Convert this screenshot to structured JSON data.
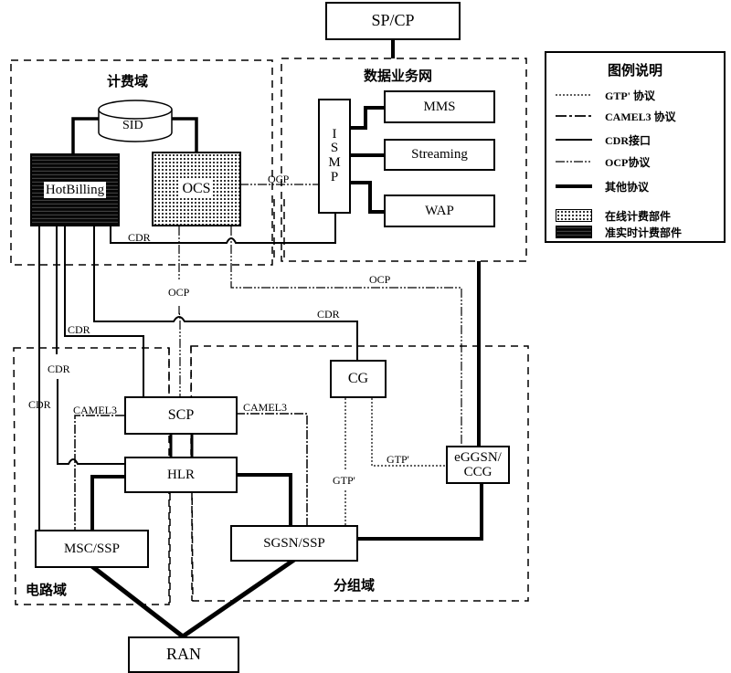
{
  "nodes": {
    "spcp": "SP/CP",
    "sid": "SID",
    "hotbilling": "HotBilling",
    "ocs": "OCS",
    "ismp": [
      "I",
      "S",
      "M",
      "P"
    ],
    "mms": "MMS",
    "streaming": "Streaming",
    "wap": "WAP",
    "cg": "CG",
    "scp": "SCP",
    "hlr": "HLR",
    "msc_ssp": "MSC/SSP",
    "sgsn_ssp": "SGSN/SSP",
    "eggsn_ccg_line1": "eGGSN/",
    "eggsn_ccg_line2": "CCG",
    "ran": "RAN"
  },
  "domains": {
    "billing": "计费域",
    "data_service": "数据业务网",
    "circuit": "电路域",
    "packet": "分组域"
  },
  "link_labels": {
    "ocp_ocs_ismp": "OCP",
    "cdr_hb_ismp": "CDR",
    "ocp_vertical": "OCP",
    "ocp_to_eggsn": "OCP",
    "cdr_to_cg": "CDR",
    "cdr_to_scp": "CDR",
    "cdr_left1": "CDR",
    "cdr_left2": "CDR",
    "camel3_left": "CAMEL3",
    "camel3_right": "CAMEL3",
    "gtp_cg_eggsn": "GTP'",
    "gtp_cg_sgsn": "GTP'"
  },
  "legend": {
    "title": "图例说明",
    "items": [
      {
        "label": "GTP' 协议",
        "style": "dotted"
      },
      {
        "label": "CAMEL3 协议",
        "style": "dash-dot"
      },
      {
        "label": "CDR接口",
        "style": "solid"
      },
      {
        "label": "OCP协议",
        "style": "dash-dot-dot"
      },
      {
        "label": "其他协议",
        "style": "thick"
      }
    ],
    "fills": [
      {
        "label": "在线计费部件",
        "fill": "dotted"
      },
      {
        "label": "准实时计费部件",
        "fill": "dark-hatched"
      }
    ]
  }
}
